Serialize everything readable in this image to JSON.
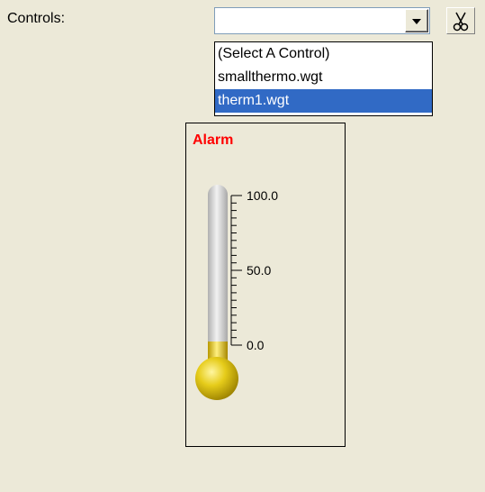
{
  "controls": {
    "label": "Controls:",
    "combo_value": "",
    "options": [
      {
        "label": "(Select A Control)",
        "selected": false
      },
      {
        "label": "smallthermo.wgt",
        "selected": false
      },
      {
        "label": "therm1.wgt",
        "selected": true
      }
    ]
  },
  "toolbar": {
    "cut_icon": "scissors-icon"
  },
  "thermometer": {
    "alarm_label": "Alarm",
    "scale_labels": [
      "100.0",
      "50.0",
      "0.0"
    ],
    "scale": {
      "min": 0,
      "max": 100
    },
    "value": 0,
    "colors": {
      "alarm": "#ff0000",
      "bulb": "#d4b800",
      "tube": "#c8c8c8"
    }
  },
  "colors": {
    "background": "#ece9d8",
    "selection": "#316ac5"
  }
}
